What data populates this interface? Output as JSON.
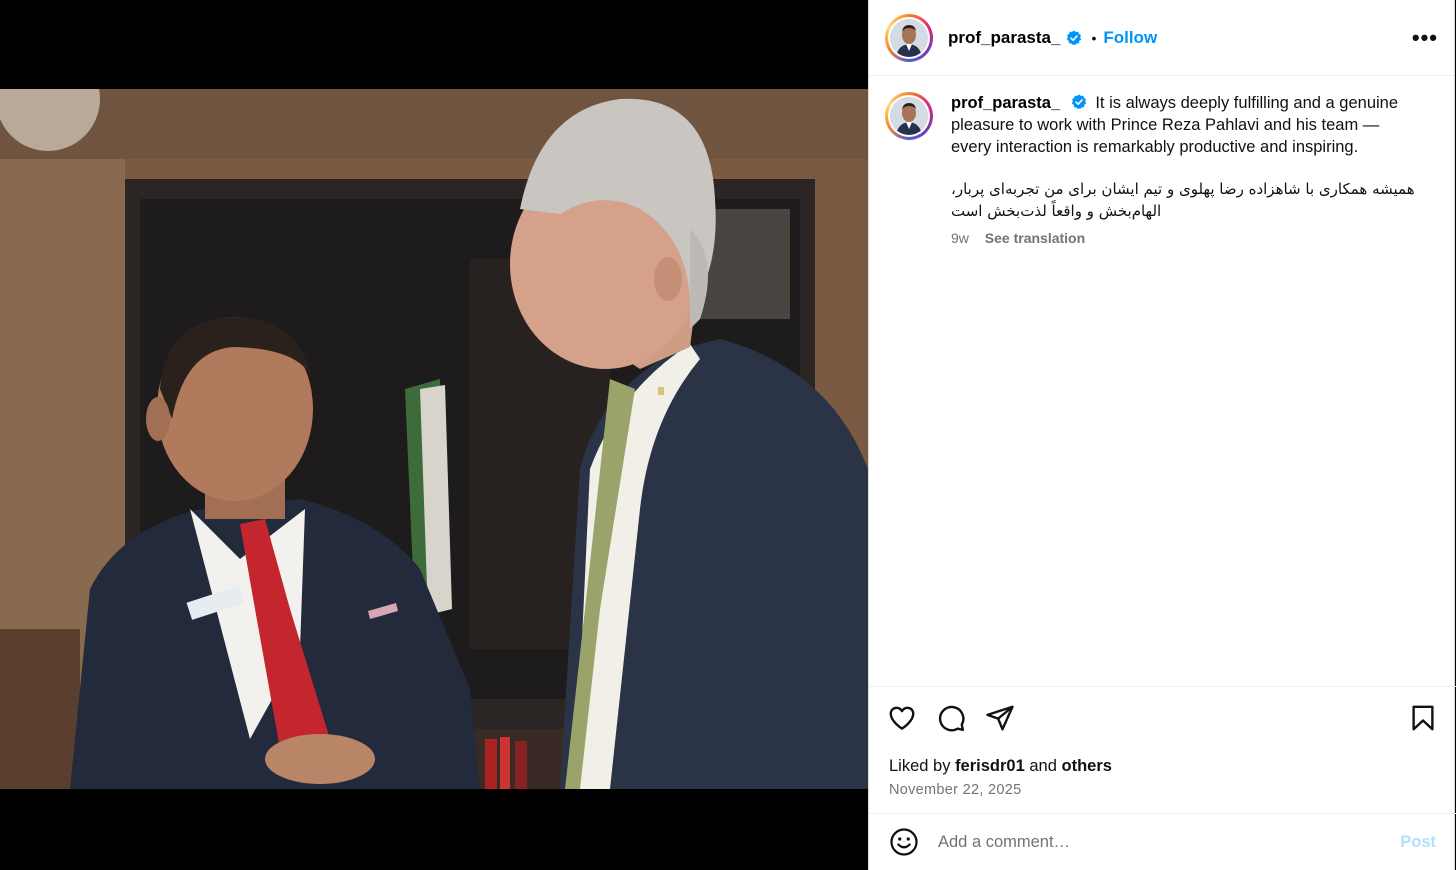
{
  "post": {
    "username": "prof_parasta_",
    "verified": true,
    "separator": "•",
    "follow_label": "Follow",
    "more_label": "•••",
    "caption_en": "It is always deeply fulfilling and a genuine pleasure to work with Prince Reza Pahlavi and his team — every interaction is remarkably productive and inspiring.",
    "caption_fa": "همیشه همکاری با شاهزاده رضا پهلوی و تیم ایشان برای من تجربه‌ای پربار، الهام‌بخش و واقعاً لذت‌بخش است",
    "age": "9w",
    "see_translation": "See translation",
    "liked_by_prefix": "Liked by",
    "liked_by_user": "ferisdr01",
    "liked_by_and": "and",
    "liked_by_others": "others",
    "date": "November 22, 2025"
  },
  "icons": {
    "verified": "verified-badge-icon",
    "like": "heart-icon",
    "comment": "comment-bubble-icon",
    "share": "paper-plane-icon",
    "save": "bookmark-icon",
    "emoji": "smiley-icon",
    "more": "more-options-icon"
  },
  "comment_box": {
    "placeholder": "Add a comment…",
    "post_label": "Post"
  },
  "colors": {
    "link_blue": "#0095f6",
    "post_disabled": "#b2dffc",
    "muted_text": "#737373",
    "verified_blue": "#0095f6"
  }
}
